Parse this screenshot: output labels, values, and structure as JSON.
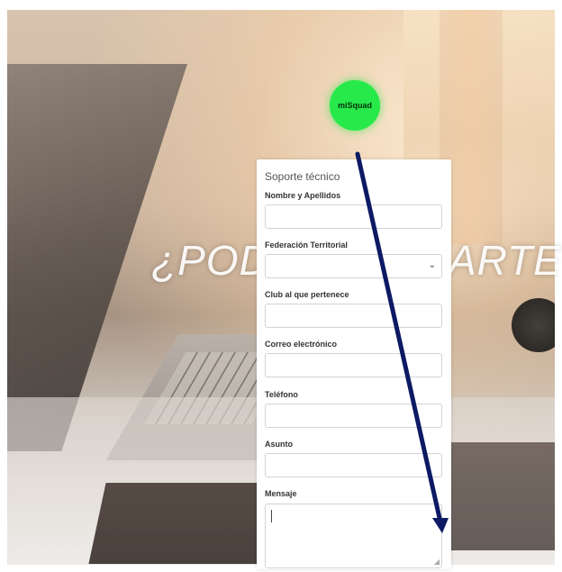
{
  "background": {
    "hero_left": "¿PODE",
    "hero_right": "ARTE?"
  },
  "logo": {
    "text": "miSquad",
    "color": "#27ea4a"
  },
  "form": {
    "title": "Soporte técnico",
    "fields": {
      "nombre": {
        "label": "Nombre y Apellidos",
        "value": ""
      },
      "federacion": {
        "label": "Federación Territorial",
        "selected": ""
      },
      "club": {
        "label": "Club al que pertenece",
        "value": ""
      },
      "correo": {
        "label": "Correo electrónico",
        "value": ""
      },
      "telefono": {
        "label": "Teléfono",
        "value": ""
      },
      "asunto": {
        "label": "Asunto",
        "value": ""
      },
      "mensaje": {
        "label": "Mensaje",
        "value": ""
      }
    }
  },
  "annotation": {
    "icon": "arrow-icon",
    "color": "#0d1a63"
  }
}
